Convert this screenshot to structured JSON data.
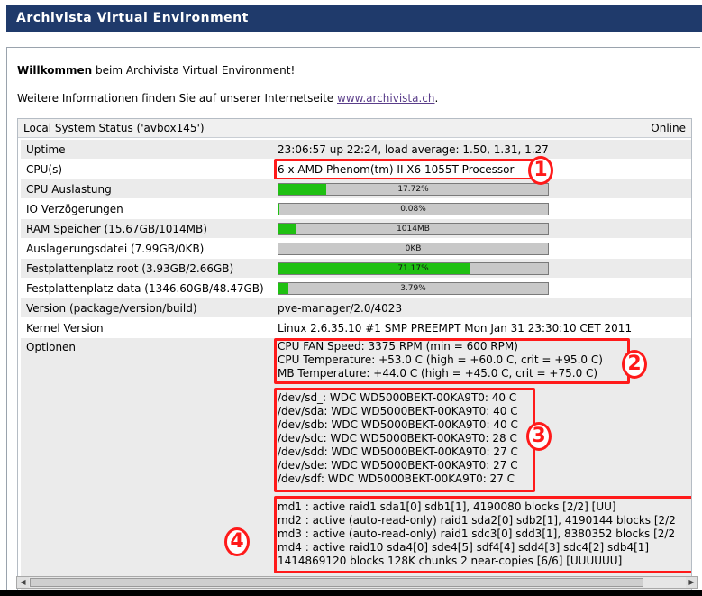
{
  "header": {
    "title": "Archivista Virtual Environment"
  },
  "welcome": {
    "bold": "Willkommen",
    "rest": " beim Archivista Virtual Environment!"
  },
  "moreinfo": {
    "text": "Weitere Informationen finden Sie auf unserer Internetseite ",
    "link": "www.archivista.ch",
    "after": "."
  },
  "status": {
    "title": "Local System Status ('avbox145')",
    "state": "Online",
    "rows": [
      {
        "label": "Uptime",
        "value": "23:06:57 up 22:24, load average: 1.50, 1.31, 1.27"
      },
      {
        "label": "CPU(s)",
        "value": "6 x AMD Phenom(tm) II X6 1055T Processor"
      },
      {
        "label": "CPU Auslastung",
        "bar": {
          "percent": 17.72,
          "text": "17.72%"
        }
      },
      {
        "label": "IO Verzögerungen",
        "bar": {
          "percent": 0.08,
          "text": "0.08%"
        }
      },
      {
        "label": "RAM Speicher (15.67GB/1014MB)",
        "bar": {
          "percent": 6.3,
          "text": "1014MB"
        }
      },
      {
        "label": "Auslagerungsdatei (7.99GB/0KB)",
        "bar": {
          "percent": 0,
          "text": "0KB"
        }
      },
      {
        "label": "Festplattenplatz root (3.93GB/2.66GB)",
        "bar": {
          "percent": 71.17,
          "text": "71.17%"
        }
      },
      {
        "label": "Festplattenplatz data (1346.60GB/48.47GB)",
        "bar": {
          "percent": 3.79,
          "text": "3.79%"
        }
      },
      {
        "label": "Version (package/version/build)",
        "value": "pve-manager/2.0/4023"
      },
      {
        "label": "Kernel Version",
        "value": "Linux 2.6.35.10 #1 SMP PREEMPT Mon Jan 31 23:30:10 CET 2011"
      }
    ],
    "options": {
      "label": "Optionen",
      "sensors": [
        "CPU FAN Speed: 3375 RPM (min = 600 RPM)",
        "CPU Temperature: +53.0 C (high = +60.0 C, crit = +95.0 C)",
        "MB Temperature: +44.0 C (high = +45.0 C, crit = +75.0 C)"
      ],
      "disks": [
        "/dev/sd_: WDC WD5000BEKT-00KA9T0: 40 C",
        "/dev/sda: WDC WD5000BEKT-00KA9T0: 40 C",
        "/dev/sdb: WDC WD5000BEKT-00KA9T0: 40 C",
        "/dev/sdc: WDC WD5000BEKT-00KA9T0: 28 C",
        "/dev/sdd: WDC WD5000BEKT-00KA9T0: 27 C",
        "/dev/sde: WDC WD5000BEKT-00KA9T0: 27 C",
        "/dev/sdf: WDC WD5000BEKT-00KA9T0: 27 C"
      ],
      "raid": [
        "md1 : active raid1 sda1[0] sdb1[1], 4190080 blocks [2/2] [UU]",
        "md2 : active (auto-read-only) raid1 sda2[0] sdb2[1], 4190144 blocks [2/2",
        "md3 : active (auto-read-only) raid1 sdc3[0] sdd3[1], 8380352 blocks [2/2",
        "md4 : active raid10 sda4[0] sde4[5] sdf4[4] sdd4[3] sdc4[2] sdb4[1]",
        "1414869120 blocks 128K chunks 2 near-copies [6/6] [UUUUUU]"
      ]
    }
  },
  "annotations": {
    "one": "1",
    "two": "2",
    "three": "3",
    "four": "4"
  },
  "colors": {
    "header_bg": "#1f3a6b",
    "bar_fill": "#1fc012",
    "annotation": "#ff1a1a"
  }
}
